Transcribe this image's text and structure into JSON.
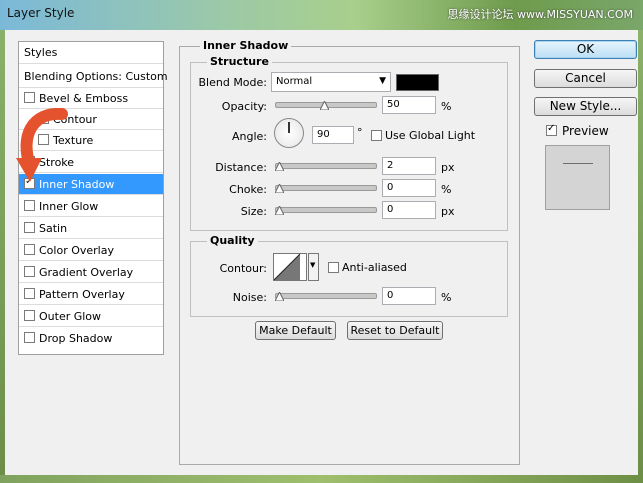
{
  "window": {
    "title": "Layer Style",
    "watermark": "思缘设计论坛 www.MISSYUAN.COM"
  },
  "styles_list": {
    "header": "Styles",
    "blending": "Blending Options: Custom",
    "items": [
      {
        "label": "Bevel & Emboss",
        "checked": false
      },
      {
        "label": "Contour",
        "checked": false
      },
      {
        "label": "Texture",
        "checked": false
      },
      {
        "label": "Stroke",
        "checked": false
      },
      {
        "label": "Inner Shadow",
        "checked": true
      },
      {
        "label": "Inner Glow",
        "checked": false
      },
      {
        "label": "Satin",
        "checked": false
      },
      {
        "label": "Color Overlay",
        "checked": false
      },
      {
        "label": "Gradient Overlay",
        "checked": false
      },
      {
        "label": "Pattern Overlay",
        "checked": false
      },
      {
        "label": "Outer Glow",
        "checked": false
      },
      {
        "label": "Drop Shadow",
        "checked": false
      }
    ]
  },
  "inner_shadow": {
    "title": "Inner Shadow",
    "structure": {
      "legend": "Structure",
      "blend_mode_label": "Blend Mode:",
      "blend_mode_value": "Normal",
      "shadow_color": "#000000",
      "opacity_label": "Opacity:",
      "opacity_value": "50",
      "opacity_unit": "%",
      "angle_label": "Angle:",
      "angle_value": "90",
      "angle_unit": "°",
      "global_light_label": "Use Global Light",
      "global_light_checked": false,
      "distance_label": "Distance:",
      "distance_value": "2",
      "distance_unit": "px",
      "choke_label": "Choke:",
      "choke_value": "0",
      "choke_unit": "%",
      "size_label": "Size:",
      "size_value": "0",
      "size_unit": "px"
    },
    "quality": {
      "legend": "Quality",
      "contour_label": "Contour:",
      "anti_aliased_label": "Anti-aliased",
      "anti_aliased_checked": false,
      "noise_label": "Noise:",
      "noise_value": "0",
      "noise_unit": "%"
    },
    "make_default": "Make Default",
    "reset_default": "Reset to Default"
  },
  "actions": {
    "ok": "OK",
    "cancel": "Cancel",
    "new_style": "New Style...",
    "preview_label": "Preview",
    "preview_checked": true
  },
  "colors": {
    "selection": "#3399ff",
    "arrow": "#e4532e"
  }
}
